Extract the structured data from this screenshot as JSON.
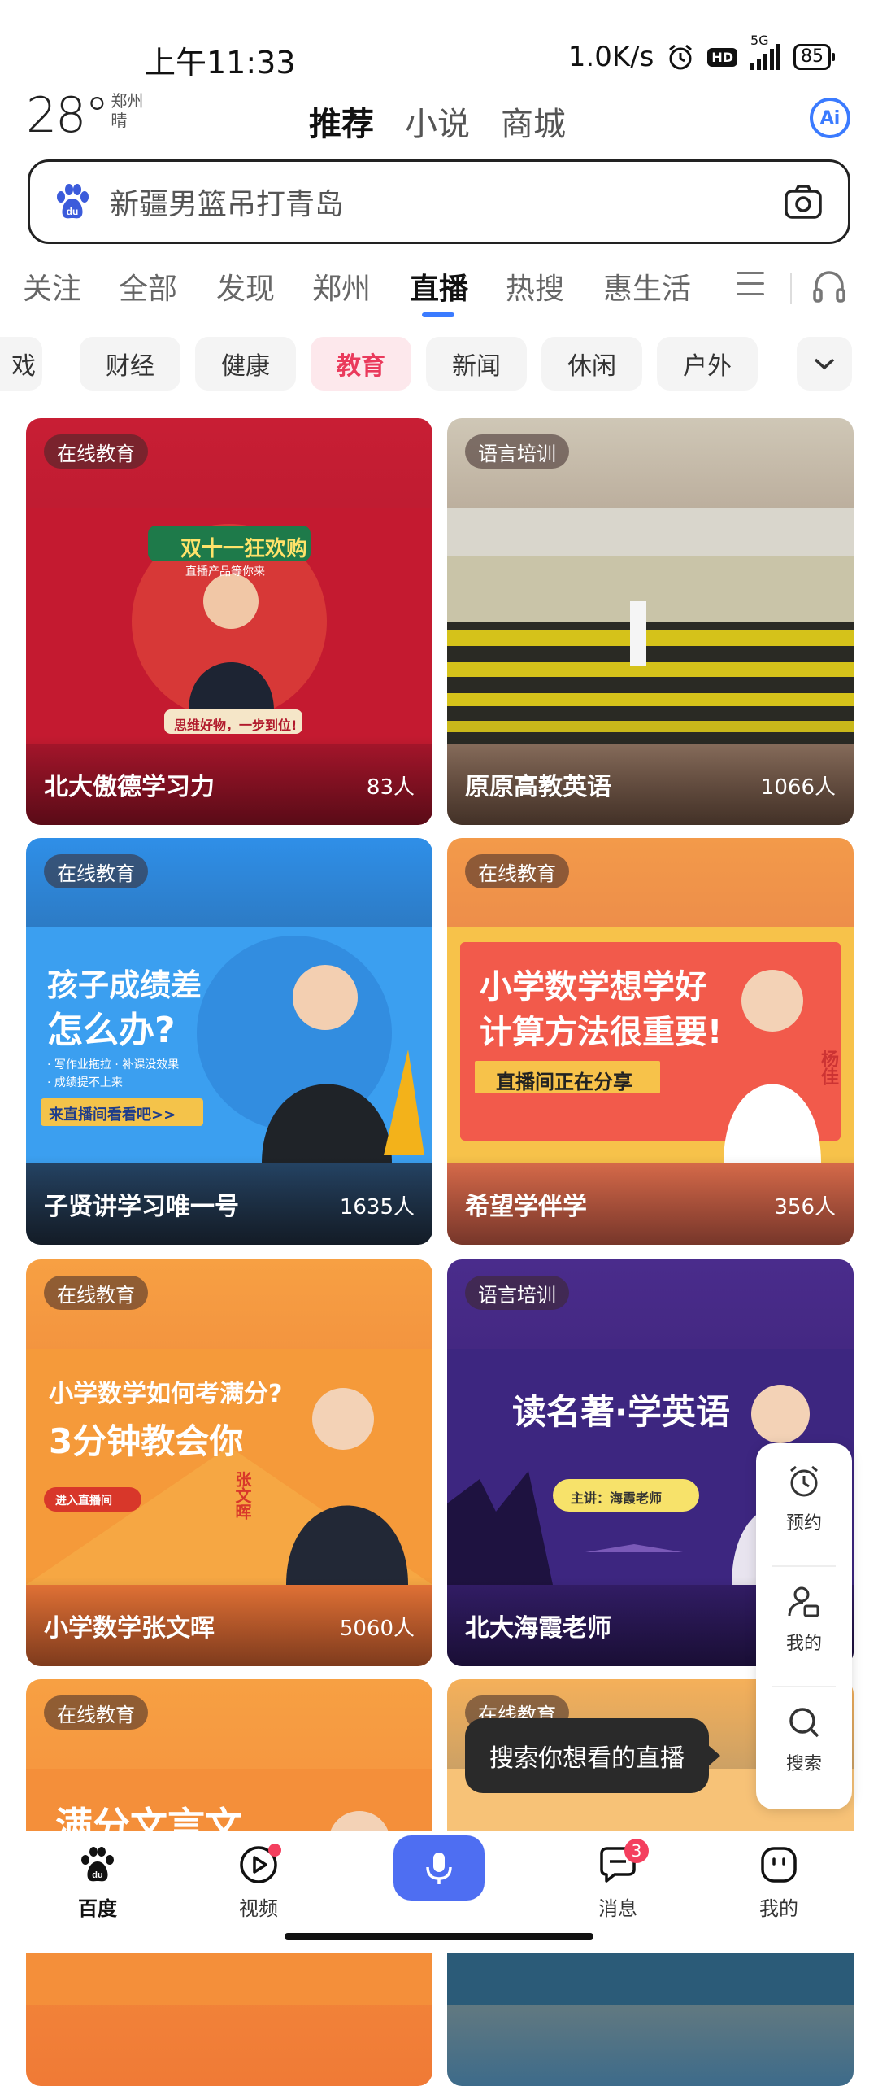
{
  "status_bar": {
    "time": "上午11:33",
    "net_speed": "1.0K/s",
    "hd": "HD",
    "network": "5G",
    "battery": "85"
  },
  "weather": {
    "temp": "28°",
    "city": "郑州",
    "condition": "晴"
  },
  "top_tabs": [
    {
      "label": "推荐",
      "active": true
    },
    {
      "label": "小说",
      "active": false
    },
    {
      "label": "商城",
      "active": false
    }
  ],
  "ai_button": "Ai",
  "search": {
    "query": "新疆男篮吊打青岛"
  },
  "channels": [
    {
      "label": "关注"
    },
    {
      "label": "全部"
    },
    {
      "label": "发现"
    },
    {
      "label": "郑州"
    },
    {
      "label": "直播",
      "active": true
    },
    {
      "label": "热搜"
    },
    {
      "label": "惠生活"
    }
  ],
  "chips": [
    {
      "label": "戏"
    },
    {
      "label": "财经"
    },
    {
      "label": "健康"
    },
    {
      "label": "教育",
      "active": true
    },
    {
      "label": "新闻"
    },
    {
      "label": "休闲"
    },
    {
      "label": "户外"
    }
  ],
  "cards": [
    {
      "tag": "在线教育",
      "title": "北大傲德学习力",
      "count": "83人",
      "poster_lines": [
        "双十一狂欢购",
        "直播产品等你来",
        "思维好物，一步到位!"
      ]
    },
    {
      "tag": "语言培训",
      "title": "原原高教英语",
      "count": "1066人",
      "poster_lines": []
    },
    {
      "tag": "在线教育",
      "title": "子贤讲学习唯一号",
      "count": "1635人",
      "poster_lines": [
        "孩子成绩差",
        "怎么办?",
        "· 写作业拖拉  · 补课没效果",
        "· 成绩提不上来",
        "来直播间看看吧>>"
      ]
    },
    {
      "tag": "在线教育",
      "title": "希望学伴学",
      "count": "356人",
      "poster_lines": [
        "小学数学想学好",
        "计算方法很重要!",
        "直播间正在分享",
        "杨佳"
      ]
    },
    {
      "tag": "在线教育",
      "title": "小学数学张文晖",
      "count": "5060人",
      "poster_lines": [
        "小学数学如何考满分?",
        "3分钟教会你",
        "进入直播间",
        "张文晖"
      ]
    },
    {
      "tag": "语言培训",
      "title": "北大海霞老师",
      "count": "",
      "poster_lines": [
        "读名著·学英语",
        "主讲：海霞老师"
      ]
    },
    {
      "tag": "在线教育",
      "title": "",
      "count": "",
      "poster_lines": [
        "满分文言文"
      ]
    },
    {
      "tag": "在线教育",
      "title": "",
      "count": "",
      "poster_lines": []
    }
  ],
  "side_panel": [
    {
      "label": "预约",
      "icon": "alarm-icon"
    },
    {
      "label": "我的",
      "icon": "user-icon"
    },
    {
      "label": "搜索",
      "icon": "search-icon"
    }
  ],
  "tooltip": "搜索你想看的直播",
  "bottom_nav": [
    {
      "label": "百度",
      "active": true
    },
    {
      "label": "视频"
    },
    {
      "label": ""
    },
    {
      "label": "消息",
      "badge": "3"
    },
    {
      "label": "我的"
    }
  ],
  "colors": {
    "accent": "#4e6ef2",
    "active_chip": "#ea3a5c",
    "badge": "#f43f5e"
  }
}
